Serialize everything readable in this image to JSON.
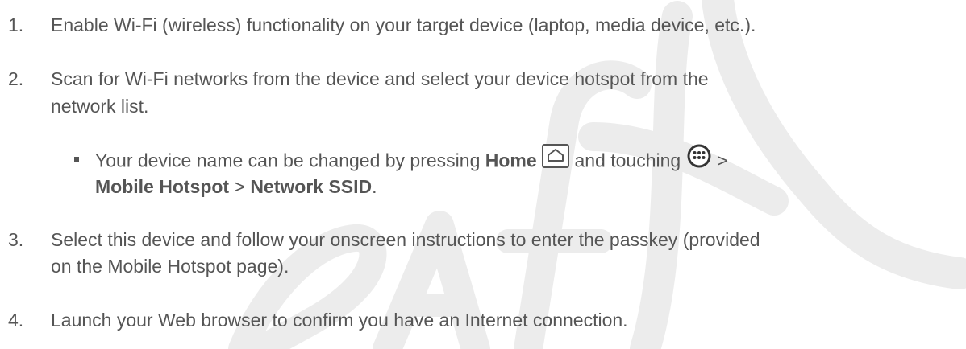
{
  "steps": [
    {
      "number": "1.",
      "lines": [
        "Enable Wi-Fi (wireless) functionality on your target device (laptop, media device, etc.)."
      ]
    },
    {
      "number": "2.",
      "lines": [
        "Scan for Wi-Fi networks from the device and select your device hotspot from the",
        "network list."
      ]
    },
    {
      "number": "3.",
      "lines": [
        "Select this device and follow your onscreen instructions to enter the passkey (provided",
        "on the Mobile Hotspot page)."
      ]
    },
    {
      "number": "4.",
      "lines": [
        "Launch your Web browser to confirm you have an Internet connection."
      ]
    }
  ],
  "note": {
    "line1_prefix": "Your device name can be changed by pressing ",
    "home_label": "Home",
    "line1_middle": " and touching ",
    "separator": " >",
    "mobile_hotspot_label": "Mobile Hotspot",
    "separator2": " > ",
    "network_ssid_label": "Network SSID",
    "end_period": "."
  },
  "icons": {
    "home_key": "home-key-icon",
    "apps_menu": "apps-menu-icon"
  },
  "watermark_text": "Draft",
  "colors": {
    "text": "#555555",
    "watermark": "#ebebeb"
  }
}
